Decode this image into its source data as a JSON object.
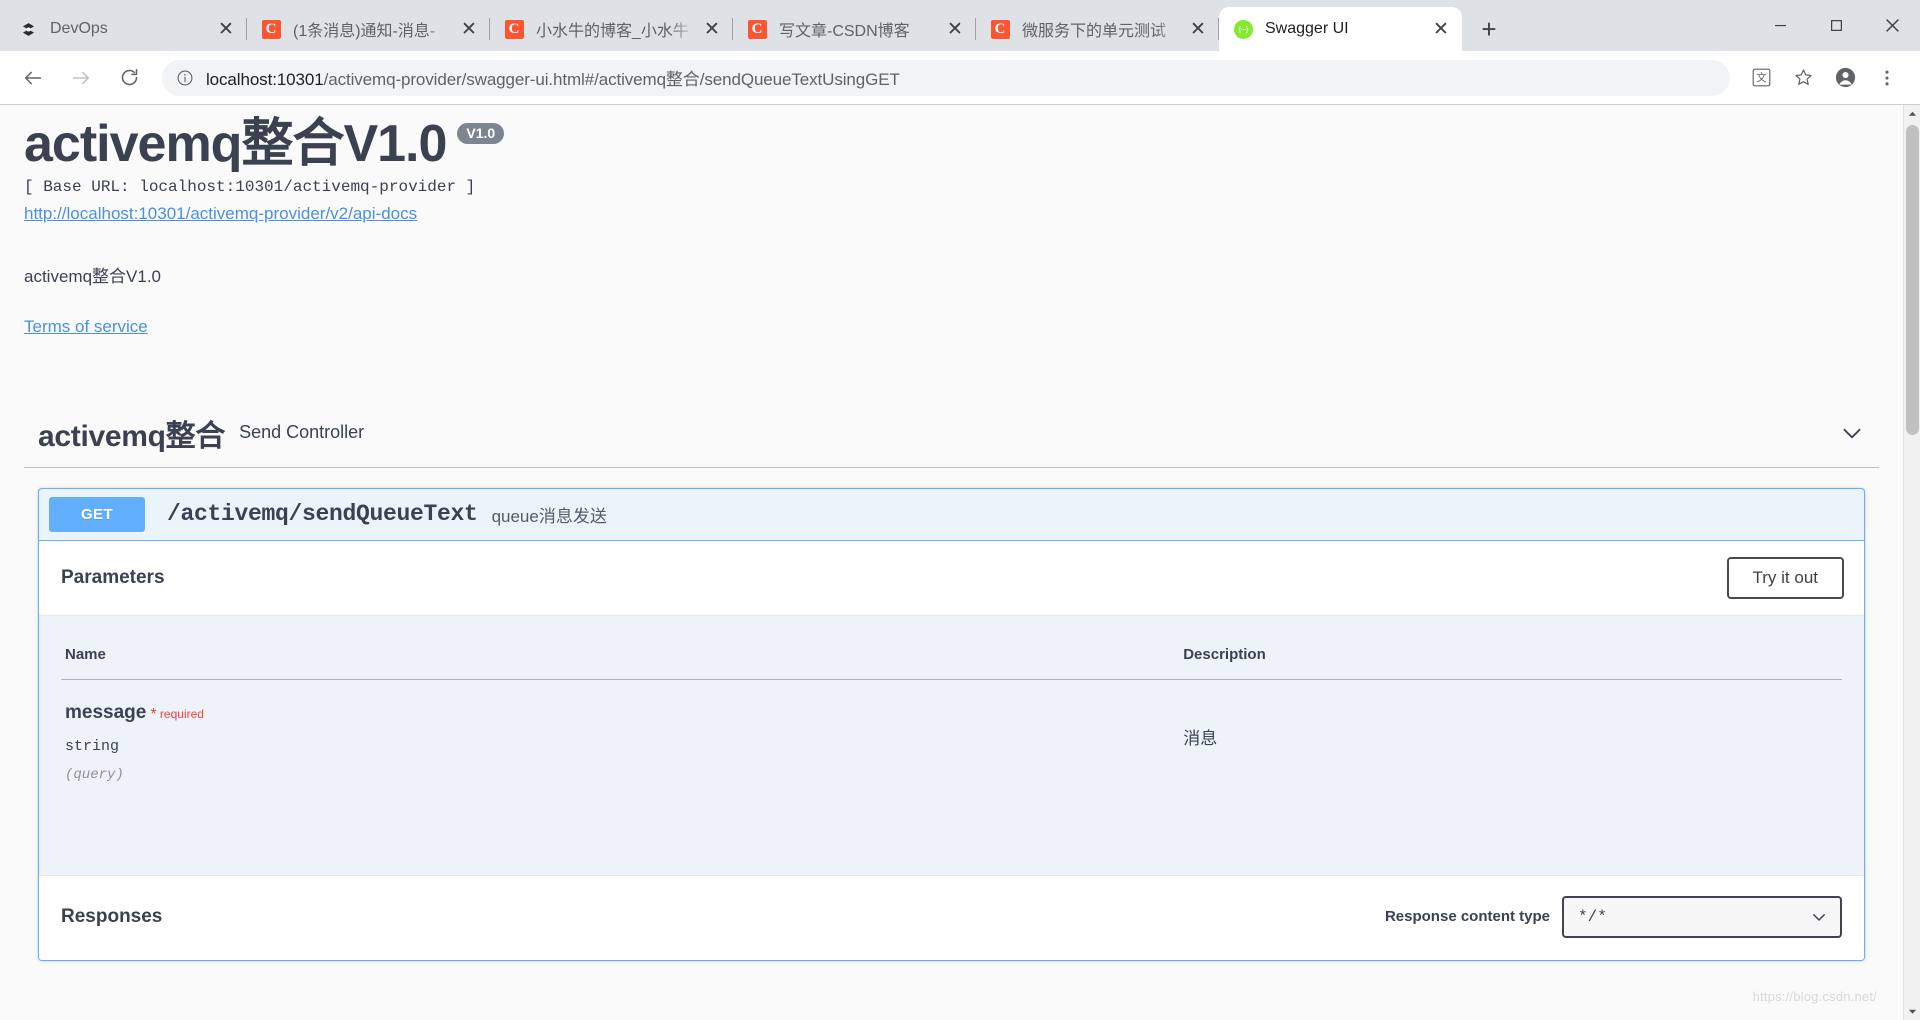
{
  "browser": {
    "tabs": [
      {
        "title": "DevOps",
        "favicon": "devops-icon",
        "active": false
      },
      {
        "title": "(1条消息)通知-消息-",
        "favicon": "csdn-icon",
        "active": false
      },
      {
        "title": "小水牛的博客_小水牛",
        "favicon": "csdn-icon",
        "active": false
      },
      {
        "title": "写文章-CSDN博客",
        "favicon": "csdn-icon",
        "active": false
      },
      {
        "title": "微服务下的单元测试",
        "favicon": "csdn-icon",
        "active": false
      },
      {
        "title": "Swagger UI",
        "favicon": "swagger-icon",
        "active": true
      }
    ],
    "new_tab_label": "+",
    "close_label": "✕",
    "window_controls": {
      "minimize": "—",
      "maximize": "▢",
      "close": "✕"
    },
    "omnibox": {
      "host": "localhost:10301",
      "path": "/activemq-provider/swagger-ui.html#/activemq整合/sendQueueTextUsingGET",
      "full_url": "localhost:10301/activemq-provider/swagger-ui.html#/activemq整合/sendQueueTextUsingGET",
      "security_icon": "info-circle-icon"
    },
    "nav": {
      "back": "back-arrow-icon",
      "forward": "forward-arrow-icon",
      "reload": "reload-icon"
    },
    "toolbar_icons": [
      "translate-icon",
      "bookmark-star-icon",
      "profile-avatar-icon",
      "chrome-menu-icon"
    ]
  },
  "swagger": {
    "title": "activemq整合V1.0",
    "version_badge": "V1.0",
    "base_url": "[ Base URL: localhost:10301/activemq-provider ]",
    "api_docs_link": "http://localhost:10301/activemq-provider/v2/api-docs",
    "description": "activemq整合V1.0",
    "terms_of_service": "Terms of service",
    "tag_section": {
      "name": "activemq整合",
      "description": "Send Controller",
      "collapse_icon": "chevron-down-icon"
    },
    "operation": {
      "method": "GET",
      "path": "/activemq/sendQueueText",
      "summary": "queue消息发送",
      "parameters_title": "Parameters",
      "try_it_out_label": "Try it out",
      "table_headers": {
        "name": "Name",
        "description": "Description"
      },
      "parameters": [
        {
          "name": "message",
          "required_label": "required",
          "required_star": "*",
          "type": "string",
          "in": "(query)",
          "description": "消息"
        }
      ],
      "responses_title": "Responses",
      "response_content_type_label": "Response content type",
      "response_content_type_value": "*/*",
      "select_chevron": "chevron-down-icon"
    }
  },
  "watermark": "https://blog.csdn.net/",
  "colors": {
    "get_method": "#61affe",
    "opblock_bg": "#ebf3fb",
    "link": "#4990e2",
    "required": "#f93e3e",
    "badge": "#7d8492"
  }
}
